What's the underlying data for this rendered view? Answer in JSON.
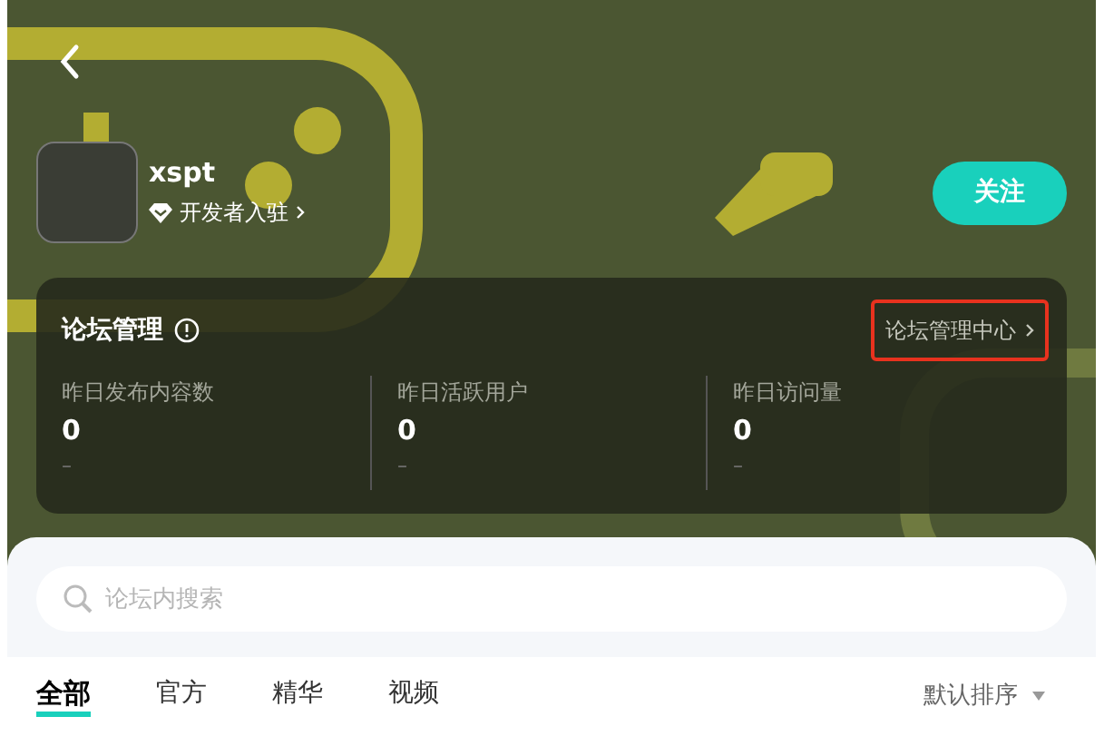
{
  "header": {
    "username": "xspt",
    "developer_link": "开发者入驻",
    "follow_button": "关注"
  },
  "forum_management": {
    "title": "论坛管理",
    "center_link": "论坛管理中心",
    "highlighted": true,
    "stats": [
      {
        "label": "昨日发布内容数",
        "value": "0",
        "change": "–"
      },
      {
        "label": "昨日活跃用户",
        "value": "0",
        "change": "–"
      },
      {
        "label": "昨日访问量",
        "value": "0",
        "change": "–"
      }
    ]
  },
  "search": {
    "placeholder": "论坛内搜索"
  },
  "tabs": [
    {
      "label": "全部",
      "selected": true
    },
    {
      "label": "官方",
      "selected": false
    },
    {
      "label": "精华",
      "selected": false
    },
    {
      "label": "视频",
      "selected": false
    }
  ],
  "sort": "默认排序"
}
